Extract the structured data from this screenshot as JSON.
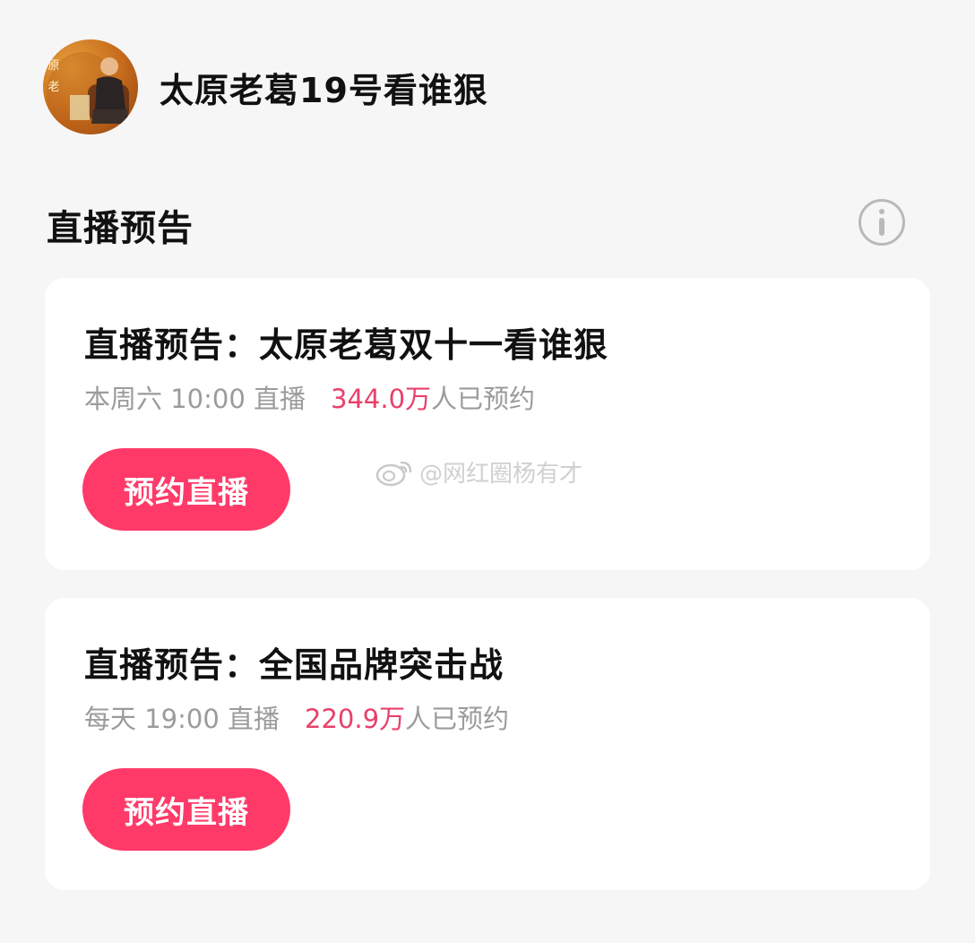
{
  "user": {
    "name": "太原老葛19号看谁狠",
    "avatar_text": "原老"
  },
  "section": {
    "title": "直播预告",
    "info_icon": "info-circle-icon"
  },
  "cards": [
    {
      "title": "直播预告：太原老葛双十一看谁狠",
      "schedule": "本周六 10:00 直播",
      "count": "344.0万",
      "count_suffix": "人已预约",
      "button": "预约直播"
    },
    {
      "title": "直播预告：全国品牌突击战",
      "schedule": "每天 19:00 直播",
      "count": "220.9万",
      "count_suffix": "人已预约",
      "button": "预约直播"
    }
  ],
  "watermark": {
    "text": "@网红圈杨有才",
    "icon": "weibo-icon"
  },
  "colors": {
    "accent": "#ff3a69",
    "count_text": "#e8406a",
    "muted_text": "#9b9b9b",
    "background": "#f6f6f6",
    "card": "#ffffff"
  }
}
